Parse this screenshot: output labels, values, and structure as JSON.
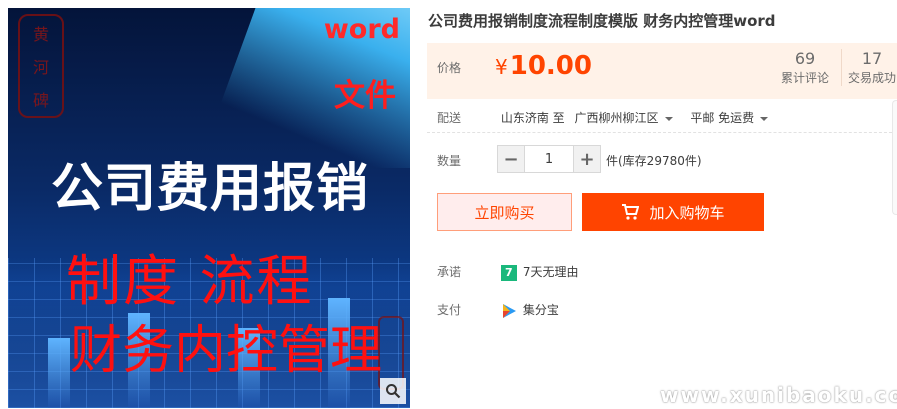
{
  "product_image": {
    "seal_chars": [
      "黄",
      "河",
      "碑"
    ],
    "badge_word": "word",
    "badge_file": "文件",
    "main_title": "公司费用报销",
    "sub_line1": "制度 流程",
    "sub_line2": "财务内控管理",
    "zoom_icon": "magnifier-icon"
  },
  "product": {
    "title": "公司费用报销制度流程制度模版 财务内控管理word"
  },
  "price": {
    "label": "价格",
    "currency": "¥",
    "amount": "10.00",
    "reviews_count": "69",
    "reviews_label": "累计评论",
    "sales_count": "17",
    "sales_label": "交易成功"
  },
  "delivery": {
    "label": "配送",
    "from": "山东济南 至",
    "to": "广西柳州柳江区",
    "shipping": "平邮 免运费"
  },
  "quantity": {
    "label": "数量",
    "minus": "−",
    "value": "1",
    "plus": "+",
    "stock": "件(库存29780件)"
  },
  "actions": {
    "buy_now": "立即购买",
    "add_to_cart": "加入购物车"
  },
  "promise": {
    "label": "承诺",
    "badge": "7",
    "text": "7天无理由"
  },
  "payment": {
    "label": "支付",
    "method": "集分宝"
  },
  "watermark": "www.xunibaoku.com",
  "colors": {
    "accent": "#ff4400",
    "price_bg": "#fff2e8",
    "promise_green": "#1ab87c"
  }
}
